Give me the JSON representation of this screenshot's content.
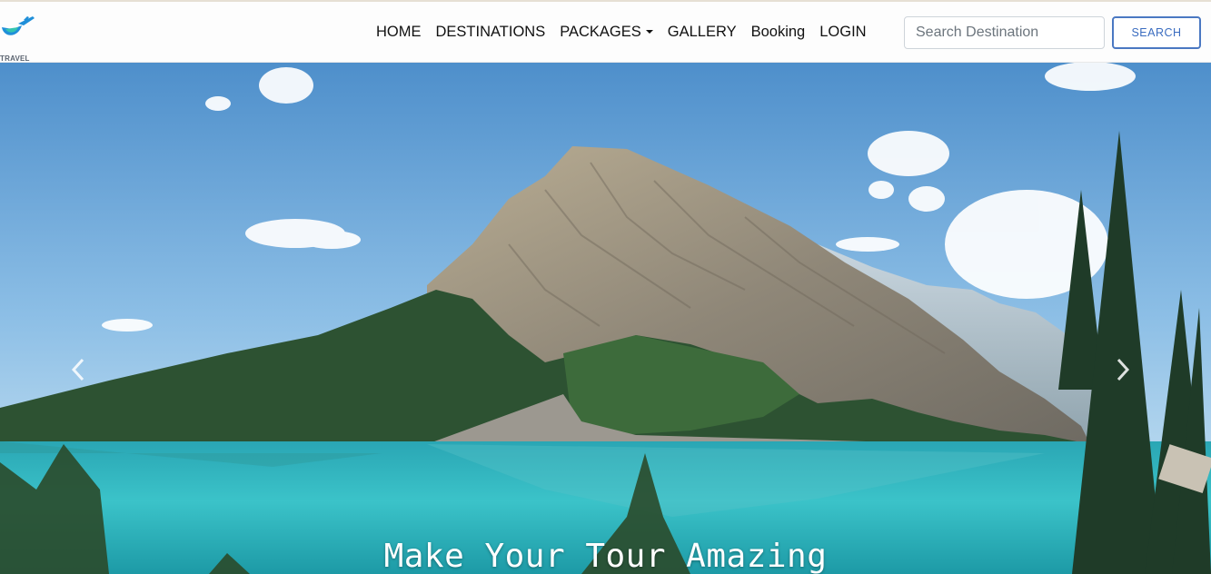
{
  "brand": {
    "logo_text": "TRAVEL"
  },
  "nav": {
    "items": [
      {
        "label": "HOME"
      },
      {
        "label": "DESTINATIONS"
      },
      {
        "label": "PACKAGES"
      },
      {
        "label": "GALLERY"
      },
      {
        "label": "Booking"
      },
      {
        "label": "LOGIN"
      }
    ]
  },
  "search": {
    "placeholder": "Search Destination",
    "value": "",
    "button_label": "SEARCH"
  },
  "hero": {
    "caption": "Make Your Tour Amazing",
    "prev_icon": "chevron-left-icon",
    "next_icon": "chevron-right-icon"
  },
  "colors": {
    "accent": "#3a6cc0",
    "sky": "#5d9bd3",
    "lake": "#2fb5bf",
    "logo_blue": "#1f8fd9"
  }
}
